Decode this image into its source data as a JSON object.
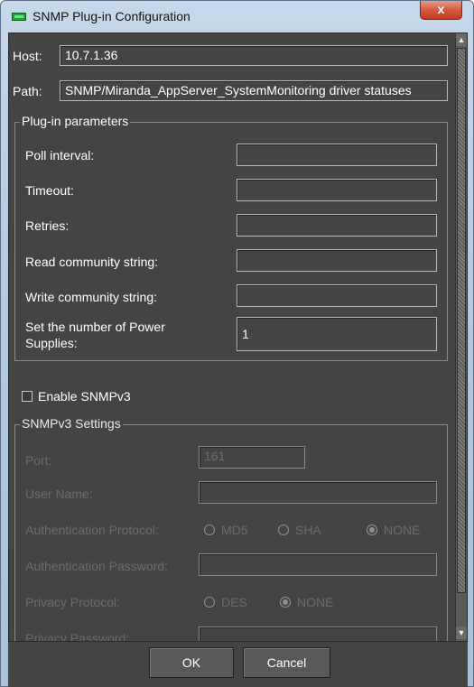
{
  "window": {
    "title": "SNMP Plug-in Configuration",
    "close_glyph": "x",
    "app_icon": "monitor-icon"
  },
  "connection": {
    "host_label": "Host:",
    "host_value": "10.7.1.36",
    "path_label": "Path:",
    "path_value": "SNMP/Miranda_AppServer_SystemMonitoring driver statuses"
  },
  "plugin_params": {
    "legend": "Plug-in parameters",
    "poll_interval_label": "Poll interval:",
    "poll_interval_value": "",
    "timeout_label": "Timeout:",
    "timeout_value": "",
    "retries_label": "Retries:",
    "retries_value": "",
    "read_community_label": "Read community string:",
    "read_community_value": "",
    "write_community_label": "Write community string:",
    "write_community_value": "",
    "power_supplies_label_line1": "Set the number of Power",
    "power_supplies_label_line2": "Supplies:",
    "power_supplies_value": "1"
  },
  "snmpv3": {
    "enable_label": "Enable SNMPv3",
    "enable_checked": false,
    "legend": "SNMPv3 Settings",
    "port_label": "Port:",
    "port_value": "161",
    "username_label": "User Name:",
    "username_value": "",
    "auth_protocol_label": "Authentication Protocol:",
    "auth_options": [
      "MD5",
      "SHA",
      "NONE"
    ],
    "auth_selected": "NONE",
    "auth_password_label": "Authentication Password:",
    "auth_password_value": "",
    "privacy_protocol_label": "Privacy Protocol:",
    "privacy_options": [
      "DES",
      "NONE"
    ],
    "privacy_selected": "NONE",
    "privacy_password_label": "Privacy Password:"
  },
  "buttons": {
    "ok": "OK",
    "cancel": "Cancel"
  },
  "colors": {
    "panel_bg": "#444444",
    "text": "#ffffff",
    "disabled_text": "#6a6a6a",
    "close_button": "#c4391d"
  }
}
